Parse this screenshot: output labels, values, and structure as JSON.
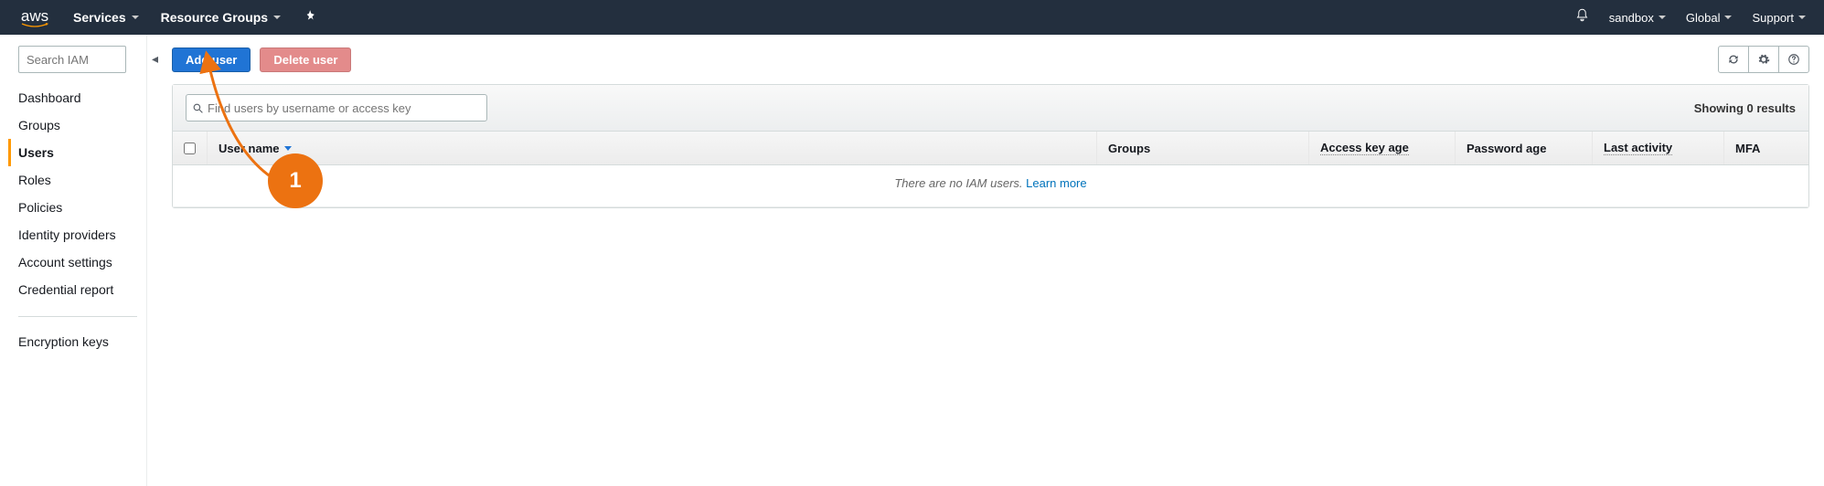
{
  "topnav": {
    "logo_text": "aws",
    "services_label": "Services",
    "resource_groups_label": "Resource Groups",
    "account_label": "sandbox",
    "region_label": "Global",
    "support_label": "Support"
  },
  "sidebar": {
    "search_placeholder": "Search IAM",
    "items": [
      {
        "label": "Dashboard",
        "active": false
      },
      {
        "label": "Groups",
        "active": false
      },
      {
        "label": "Users",
        "active": true
      },
      {
        "label": "Roles",
        "active": false
      },
      {
        "label": "Policies",
        "active": false
      },
      {
        "label": "Identity providers",
        "active": false
      },
      {
        "label": "Account settings",
        "active": false
      },
      {
        "label": "Credential report",
        "active": false
      }
    ],
    "secondary_items": [
      {
        "label": "Encryption keys"
      }
    ]
  },
  "actions": {
    "add_user_label": "Add user",
    "delete_user_label": "Delete user"
  },
  "search": {
    "placeholder": "Find users by username or access key"
  },
  "results": {
    "text": "Showing 0 results"
  },
  "columns": {
    "username": "User name",
    "groups": "Groups",
    "keyage": "Access key age",
    "pwdage": "Password age",
    "last": "Last activity",
    "mfa": "MFA"
  },
  "empty": {
    "text": "There are no IAM users. ",
    "link_text": "Learn more"
  },
  "annotation": {
    "step": "1"
  }
}
